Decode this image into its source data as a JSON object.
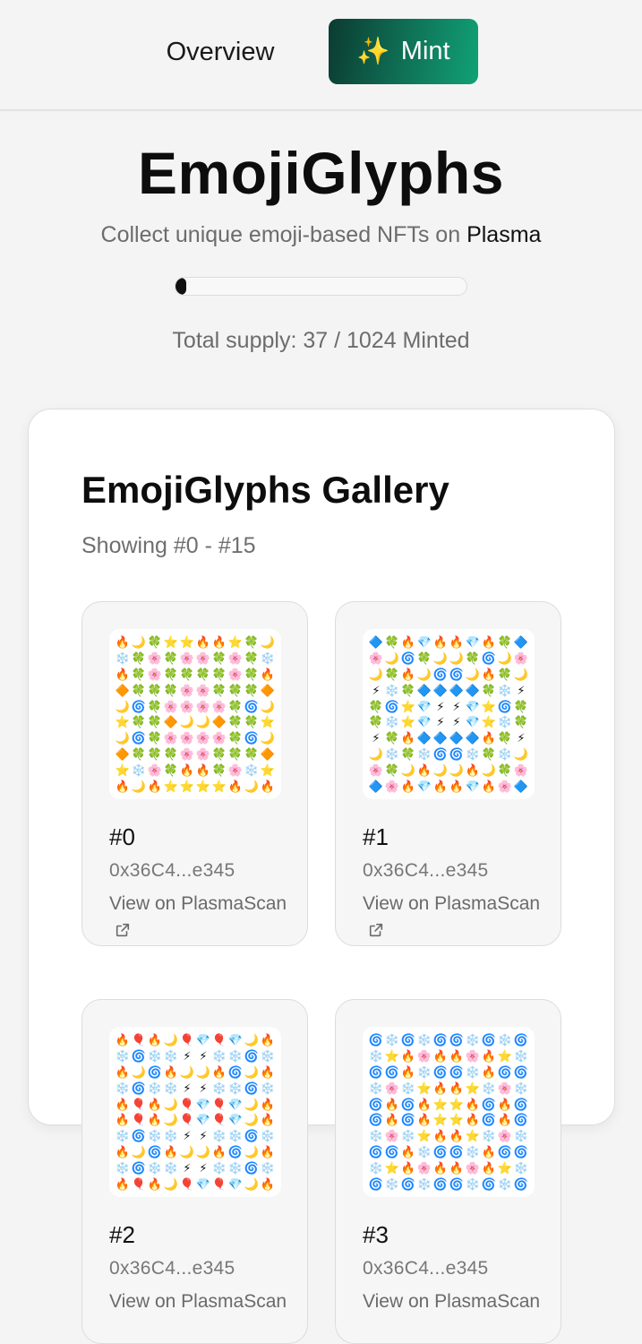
{
  "nav": {
    "overview_label": "Overview",
    "mint_label": "Mint",
    "mint_icon": "sparkles-icon",
    "mint_gradient": [
      "#0b3b30",
      "#10a276"
    ]
  },
  "hero": {
    "title": "EmojiGlyphs",
    "subtitle_prefix": "Collect unique emoji-based NFTs on ",
    "chain_name": "Plasma",
    "minted": 37,
    "max_supply": 1024,
    "supply_text": "Total supply: 37 / 1024 Minted"
  },
  "gallery": {
    "title": "EmojiGlyphs Gallery",
    "range_text": "Showing #0 - #15",
    "items": [
      {
        "id_label": "#0",
        "owner": "0x36C4...e345",
        "link_label": "View on PlasmaScan",
        "link_icon": "external-link-icon",
        "glyphs": [
          [
            "🔥",
            "🌙",
            "🍀",
            "⭐",
            "⭐",
            "🔥",
            "🔥",
            "⭐",
            "🍀",
            "🌙"
          ],
          [
            "❄️",
            "🍀",
            "🌸",
            "🍀",
            "🌸",
            "🌸",
            "🍀",
            "🌸",
            "🍀",
            "❄️"
          ],
          [
            "🔥",
            "🍀",
            "🌸",
            "🍀",
            "🍀",
            "🍀",
            "🍀",
            "🌸",
            "🍀",
            "🔥"
          ],
          [
            "🔶",
            "🍀",
            "🍀",
            "🍀",
            "🌸",
            "🌸",
            "🍀",
            "🍀",
            "🍀",
            "🔶"
          ],
          [
            "🌙",
            "🌀",
            "🍀",
            "🌸",
            "🌸",
            "🌸",
            "🌸",
            "🍀",
            "🌀",
            "🌙"
          ],
          [
            "⭐",
            "🍀",
            "🍀",
            "🔶",
            "🌙",
            "🌙",
            "🔶",
            "🍀",
            "🍀",
            "⭐"
          ],
          [
            "🌙",
            "🌀",
            "🍀",
            "🌸",
            "🌸",
            "🌸",
            "🌸",
            "🍀",
            "🌀",
            "🌙"
          ],
          [
            "🔶",
            "🍀",
            "🍀",
            "🍀",
            "🌸",
            "🌸",
            "🍀",
            "🍀",
            "🍀",
            "🔶"
          ],
          [
            "⭐",
            "❄️",
            "🌸",
            "🍀",
            "🔥",
            "🔥",
            "🍀",
            "🌸",
            "❄️",
            "⭐"
          ],
          [
            "🔥",
            "🌙",
            "🔥",
            "⭐",
            "⭐",
            "⭐",
            "⭐",
            "🔥",
            "🌙",
            "🔥"
          ]
        ]
      },
      {
        "id_label": "#1",
        "owner": "0x36C4...e345",
        "link_label": "View on PlasmaScan",
        "link_icon": "external-link-icon",
        "glyphs": [
          [
            "🔷",
            "🍀",
            "🔥",
            "💎",
            "🔥",
            "🔥",
            "💎",
            "🔥",
            "🍀",
            "🔷"
          ],
          [
            "🌸",
            "🌙",
            "🌀",
            "🍀",
            "🌙",
            "🌙",
            "🍀",
            "🌀",
            "🌙",
            "🌸"
          ],
          [
            "🌙",
            "🍀",
            "🔥",
            "🌙",
            "🌀",
            "🌀",
            "🌙",
            "🔥",
            "🍀",
            "🌙"
          ],
          [
            "⚡",
            "❄️",
            "🍀",
            "🔷",
            "🔷",
            "🔷",
            "🔷",
            "🍀",
            "❄️",
            "⚡"
          ],
          [
            "🍀",
            "🌀",
            "⭐",
            "💎",
            "⚡",
            "⚡",
            "💎",
            "⭐",
            "🌀",
            "🍀"
          ],
          [
            "🍀",
            "❄️",
            "⭐",
            "💎",
            "⚡",
            "⚡",
            "💎",
            "⭐",
            "❄️",
            "🍀"
          ],
          [
            "⚡",
            "🍀",
            "🔥",
            "🔷",
            "🔷",
            "🔷",
            "🔷",
            "🔥",
            "🍀",
            "⚡"
          ],
          [
            "🌙",
            "❄️",
            "🍀",
            "❄️",
            "🌀",
            "🌀",
            "❄️",
            "🍀",
            "❄️",
            "🌙"
          ],
          [
            "🌸",
            "🍀",
            "🌙",
            "🔥",
            "🌙",
            "🌙",
            "🔥",
            "🌙",
            "🍀",
            "🌸"
          ],
          [
            "🔷",
            "🌸",
            "🔥",
            "💎",
            "🔥",
            "🔥",
            "💎",
            "🔥",
            "🌸",
            "🔷"
          ]
        ]
      },
      {
        "id_label": "#2",
        "owner": "0x36C4...e345",
        "link_label": "View on PlasmaScan",
        "link_icon": "external-link-icon",
        "glyphs": [
          [
            "🔥",
            "🎈",
            "🔥",
            "🌙",
            "🎈",
            "💎",
            "🎈",
            "💎",
            "🌙",
            "🔥"
          ],
          [
            "❄️",
            "🌀",
            "❄️",
            "❄️",
            "⚡",
            "⚡",
            "❄️",
            "❄️",
            "🌀",
            "❄️"
          ],
          [
            "🔥",
            "🌙",
            "🌀",
            "🔥",
            "🌙",
            "🌙",
            "🔥",
            "🌀",
            "🌙",
            "🔥"
          ],
          [
            "❄️",
            "🌀",
            "❄️",
            "❄️",
            "⚡",
            "⚡",
            "❄️",
            "❄️",
            "🌀",
            "❄️"
          ],
          [
            "🔥",
            "🎈",
            "🔥",
            "🌙",
            "🎈",
            "💎",
            "🎈",
            "💎",
            "🌙",
            "🔥"
          ],
          [
            "🔥",
            "🎈",
            "🔥",
            "🌙",
            "🎈",
            "💎",
            "🎈",
            "💎",
            "🌙",
            "🔥"
          ],
          [
            "❄️",
            "🌀",
            "❄️",
            "❄️",
            "⚡",
            "⚡",
            "❄️",
            "❄️",
            "🌀",
            "❄️"
          ],
          [
            "🔥",
            "🌙",
            "🌀",
            "🔥",
            "🌙",
            "🌙",
            "🔥",
            "🌀",
            "🌙",
            "🔥"
          ],
          [
            "❄️",
            "🌀",
            "❄️",
            "❄️",
            "⚡",
            "⚡",
            "❄️",
            "❄️",
            "🌀",
            "❄️"
          ],
          [
            "🔥",
            "🎈",
            "🔥",
            "🌙",
            "🎈",
            "💎",
            "🎈",
            "💎",
            "🌙",
            "🔥"
          ]
        ]
      },
      {
        "id_label": "#3",
        "owner": "0x36C4...e345",
        "link_label": "View on PlasmaScan",
        "link_icon": "external-link-icon",
        "glyphs": [
          [
            "🌀",
            "❄️",
            "🌀",
            "❄️",
            "🌀",
            "🌀",
            "❄️",
            "🌀",
            "❄️",
            "🌀"
          ],
          [
            "❄️",
            "⭐",
            "🔥",
            "🌸",
            "🔥",
            "🔥",
            "🌸",
            "🔥",
            "⭐",
            "❄️"
          ],
          [
            "🌀",
            "🌀",
            "🔥",
            "❄️",
            "🌀",
            "🌀",
            "❄️",
            "🔥",
            "🌀",
            "🌀"
          ],
          [
            "❄️",
            "🌸",
            "❄️",
            "⭐",
            "🔥",
            "🔥",
            "⭐",
            "❄️",
            "🌸",
            "❄️"
          ],
          [
            "🌀",
            "🔥",
            "🌀",
            "🔥",
            "⭐",
            "⭐",
            "🔥",
            "🌀",
            "🔥",
            "🌀"
          ],
          [
            "🌀",
            "🔥",
            "🌀",
            "🔥",
            "⭐",
            "⭐",
            "🔥",
            "🌀",
            "🔥",
            "🌀"
          ],
          [
            "❄️",
            "🌸",
            "❄️",
            "⭐",
            "🔥",
            "🔥",
            "⭐",
            "❄️",
            "🌸",
            "❄️"
          ],
          [
            "🌀",
            "🌀",
            "🔥",
            "❄️",
            "🌀",
            "🌀",
            "❄️",
            "🔥",
            "🌀",
            "🌀"
          ],
          [
            "❄️",
            "⭐",
            "🔥",
            "🌸",
            "🔥",
            "🔥",
            "🌸",
            "🔥",
            "⭐",
            "❄️"
          ],
          [
            "🌀",
            "❄️",
            "🌀",
            "❄️",
            "🌀",
            "🌀",
            "❄️",
            "🌀",
            "❄️",
            "🌀"
          ]
        ]
      }
    ]
  },
  "colors": {
    "page_background": "#f4f4f4",
    "card_background": "#ffffff",
    "muted_text": "#6c6c6c",
    "progress_fill": "#111111"
  }
}
